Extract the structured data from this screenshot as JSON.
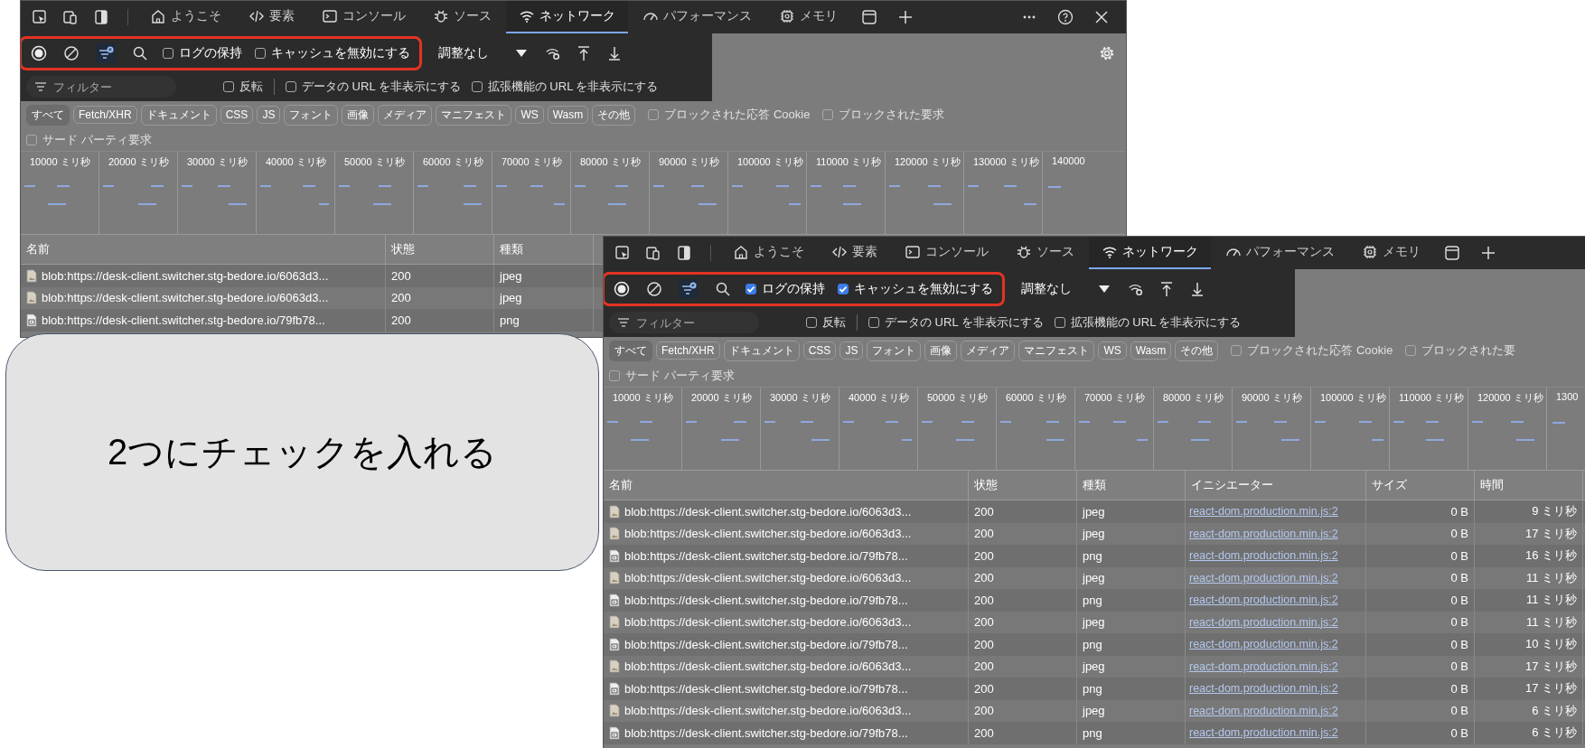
{
  "panels": [
    {
      "window_controls": true,
      "settings_button": true,
      "tabs": [
        {
          "label": "ようこそ",
          "kind": "home",
          "selected": false
        },
        {
          "label": "要素",
          "kind": "code",
          "selected": false
        },
        {
          "label": "コンソール",
          "kind": "console",
          "selected": false
        },
        {
          "label": "ソース",
          "kind": "bug",
          "selected": false
        },
        {
          "label": "ネットワーク",
          "kind": "wifi",
          "selected": true
        },
        {
          "label": "パフォーマンス",
          "kind": "gauge",
          "selected": false
        },
        {
          "label": "メモリ",
          "kind": "chip",
          "selected": false
        }
      ],
      "toolbar": {
        "checkboxes": [
          {
            "label": "ログの保持",
            "checked": false
          },
          {
            "label": "キャッシュを無効にする",
            "checked": false
          }
        ],
        "throttle": "調整なし"
      },
      "filter": {
        "placeholder": "フィルター",
        "checkboxes": [
          {
            "label": "反転",
            "checked": false
          },
          {
            "label": "データの URL を非表示にする",
            "checked": false
          },
          {
            "label": "拡張機能の URL を非表示にする",
            "checked": false
          }
        ]
      },
      "type_filters": [
        {
          "label": "すべて",
          "selected": true
        },
        {
          "label": "Fetch/XHR",
          "selected": false
        },
        {
          "label": "ドキュメント",
          "selected": false
        },
        {
          "label": "CSS",
          "selected": false
        },
        {
          "label": "JS",
          "selected": false
        },
        {
          "label": "フォント",
          "selected": false
        },
        {
          "label": "画像",
          "selected": false
        },
        {
          "label": "メディア",
          "selected": false
        },
        {
          "label": "マニフェスト",
          "selected": false
        },
        {
          "label": "WS",
          "selected": false
        },
        {
          "label": "Wasm",
          "selected": false
        },
        {
          "label": "その他",
          "selected": false
        }
      ],
      "blocked_checkboxes": [
        {
          "label": "ブロックされた応答 Cookie",
          "checked": false
        },
        {
          "label": "ブロックされた要求",
          "checked": false
        }
      ],
      "third_party": {
        "label": "サード パーティ要求",
        "checked": false
      },
      "timeline": [
        "10000 ミリ秒",
        "20000 ミリ秒",
        "30000 ミリ秒",
        "40000 ミリ秒",
        "50000 ミリ秒",
        "60000 ミリ秒",
        "70000 ミリ秒",
        "80000 ミリ秒",
        "90000 ミリ秒",
        "100000 ミリ秒",
        "110000 ミリ秒",
        "120000 ミリ秒",
        "130000 ミリ秒",
        "140000"
      ],
      "columns": [
        {
          "label": "名前",
          "kind": "name"
        },
        {
          "label": "状態",
          "kind": "text"
        },
        {
          "label": "種類",
          "kind": "rest"
        }
      ],
      "rows": [
        {
          "kind": "photo",
          "cells": [
            "blob:https://desk-client.switcher.stg-bedore.io/6063d3...",
            "200",
            "jpeg"
          ]
        },
        {
          "kind": "photo",
          "cells": [
            "blob:https://desk-client.switcher.stg-bedore.io/6063d3...",
            "200",
            "jpeg"
          ]
        },
        {
          "kind": "picture",
          "cells": [
            "blob:https://desk-client.switcher.stg-bedore.io/79fb78...",
            "200",
            "png"
          ]
        }
      ]
    },
    {
      "window_controls": false,
      "settings_button": false,
      "tabs": [
        {
          "label": "ようこそ",
          "kind": "home",
          "selected": false
        },
        {
          "label": "要素",
          "kind": "code",
          "selected": false
        },
        {
          "label": "コンソール",
          "kind": "console",
          "selected": false
        },
        {
          "label": "ソース",
          "kind": "bug",
          "selected": false
        },
        {
          "label": "ネットワーク",
          "kind": "wifi",
          "selected": true
        },
        {
          "label": "パフォーマンス",
          "kind": "gauge",
          "selected": false
        },
        {
          "label": "メモリ",
          "kind": "chip",
          "selected": false
        }
      ],
      "toolbar": {
        "checkboxes": [
          {
            "label": "ログの保持",
            "checked": true
          },
          {
            "label": "キャッシュを無効にする",
            "checked": true
          }
        ],
        "throttle": "調整なし"
      },
      "filter": {
        "placeholder": "フィルター",
        "checkboxes": [
          {
            "label": "反転",
            "checked": false
          },
          {
            "label": "データの URL を非表示にする",
            "checked": false
          },
          {
            "label": "拡張機能の URL を非表示にする",
            "checked": false
          }
        ]
      },
      "type_filters": [
        {
          "label": "すべて",
          "selected": true
        },
        {
          "label": "Fetch/XHR",
          "selected": false
        },
        {
          "label": "ドキュメント",
          "selected": false
        },
        {
          "label": "CSS",
          "selected": false
        },
        {
          "label": "JS",
          "selected": false
        },
        {
          "label": "フォント",
          "selected": false
        },
        {
          "label": "画像",
          "selected": false
        },
        {
          "label": "メディア",
          "selected": false
        },
        {
          "label": "マニフェスト",
          "selected": false
        },
        {
          "label": "WS",
          "selected": false
        },
        {
          "label": "Wasm",
          "selected": false
        },
        {
          "label": "その他",
          "selected": false
        }
      ],
      "blocked_checkboxes": [
        {
          "label": "ブロックされた応答 Cookie",
          "checked": false
        },
        {
          "label": "ブロックされた要",
          "checked": false
        }
      ],
      "third_party": {
        "label": "サード パーティ要求",
        "checked": false
      },
      "timeline": [
        "10000 ミリ秒",
        "20000 ミリ秒",
        "30000 ミリ秒",
        "40000 ミリ秒",
        "50000 ミリ秒",
        "60000 ミリ秒",
        "70000 ミリ秒",
        "80000 ミリ秒",
        "90000 ミリ秒",
        "100000 ミリ秒",
        "110000 ミリ秒",
        "120000 ミリ秒",
        "1300"
      ],
      "columns": [
        {
          "label": "名前",
          "kind": "name"
        },
        {
          "label": "状態",
          "kind": "text"
        },
        {
          "label": "種類",
          "kind": "text"
        },
        {
          "label": "イニシエーター",
          "kind": "link"
        },
        {
          "label": "サイズ",
          "kind": "number"
        },
        {
          "label": "時間",
          "kind": "number"
        }
      ],
      "rows": [
        {
          "kind": "photo",
          "cells": [
            "blob:https://desk-client.switcher.stg-bedore.io/6063d3...",
            "200",
            "jpeg",
            "react-dom.production.min.js:2",
            "0 B",
            "9 ミリ秒"
          ]
        },
        {
          "kind": "photo",
          "cells": [
            "blob:https://desk-client.switcher.stg-bedore.io/6063d3...",
            "200",
            "jpeg",
            "react-dom.production.min.js:2",
            "0 B",
            "17 ミリ秒"
          ]
        },
        {
          "kind": "picture",
          "cells": [
            "blob:https://desk-client.switcher.stg-bedore.io/79fb78...",
            "200",
            "png",
            "react-dom.production.min.js:2",
            "0 B",
            "16 ミリ秒"
          ]
        },
        {
          "kind": "photo",
          "cells": [
            "blob:https://desk-client.switcher.stg-bedore.io/6063d3...",
            "200",
            "jpeg",
            "react-dom.production.min.js:2",
            "0 B",
            "11 ミリ秒"
          ]
        },
        {
          "kind": "picture",
          "cells": [
            "blob:https://desk-client.switcher.stg-bedore.io/79fb78...",
            "200",
            "png",
            "react-dom.production.min.js:2",
            "0 B",
            "11 ミリ秒"
          ]
        },
        {
          "kind": "photo",
          "cells": [
            "blob:https://desk-client.switcher.stg-bedore.io/6063d3...",
            "200",
            "jpeg",
            "react-dom.production.min.js:2",
            "0 B",
            "11 ミリ秒"
          ]
        },
        {
          "kind": "picture",
          "cells": [
            "blob:https://desk-client.switcher.stg-bedore.io/79fb78...",
            "200",
            "png",
            "react-dom.production.min.js:2",
            "0 B",
            "10 ミリ秒"
          ]
        },
        {
          "kind": "photo",
          "cells": [
            "blob:https://desk-client.switcher.stg-bedore.io/6063d3...",
            "200",
            "jpeg",
            "react-dom.production.min.js:2",
            "0 B",
            "17 ミリ秒"
          ]
        },
        {
          "kind": "picture",
          "cells": [
            "blob:https://desk-client.switcher.stg-bedore.io/79fb78...",
            "200",
            "png",
            "react-dom.production.min.js:2",
            "0 B",
            "17 ミリ秒"
          ]
        },
        {
          "kind": "photo",
          "cells": [
            "blob:https://desk-client.switcher.stg-bedore.io/6063d3...",
            "200",
            "jpeg",
            "react-dom.production.min.js:2",
            "0 B",
            "6 ミリ秒"
          ]
        },
        {
          "kind": "picture",
          "cells": [
            "blob:https://desk-client.switcher.stg-bedore.io/79fb78...",
            "200",
            "png",
            "react-dom.production.min.js:2",
            "0 B",
            "6 ミリ秒"
          ]
        }
      ]
    }
  ],
  "callout": {
    "text": "2つにチェックを入れる"
  }
}
